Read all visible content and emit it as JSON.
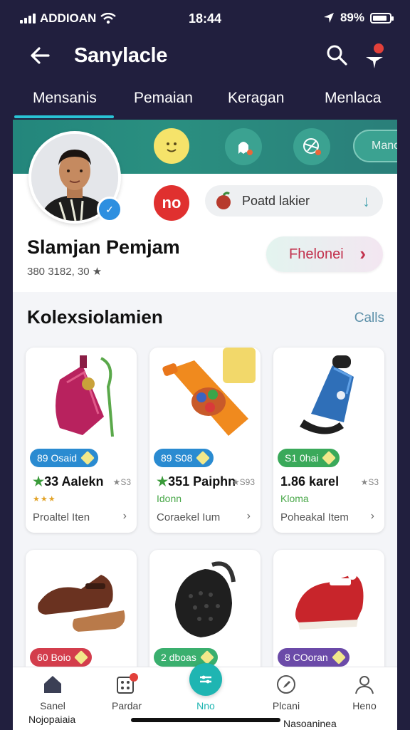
{
  "status": {
    "carrier": "ADDIOAN",
    "time": "18:44",
    "battery": "89%"
  },
  "header": {
    "title": "Sanylacle"
  },
  "tabs": [
    "Mensanis",
    "Pemaian",
    "Keragan",
    "Menlaca"
  ],
  "hero": {
    "chip_text": "Mano"
  },
  "profile": {
    "name": "Slamjan Pemjam",
    "meta": "380 3182, 30 ★",
    "badge_text": "no",
    "pill_label": "Poatd lakier",
    "follow_label": "Fhelonei"
  },
  "collection": {
    "title": "Kolexsiolamien",
    "link": "Calls",
    "items": [
      {
        "tag": "89 Osaid",
        "tag_color": "#2a8bd1",
        "name": "33 Aalekn",
        "name_star": "★",
        "rate": "★S3",
        "sub": "★★★",
        "foot": "Proaltel Iten"
      },
      {
        "tag": "89 S08",
        "tag_color": "#2a8bd1",
        "name": "351 Paiphn",
        "name_star": "★",
        "rate": "★S93",
        "sub": "Idonn",
        "foot": "Coraekel Ium"
      },
      {
        "tag": "S1 0hai",
        "tag_color": "#3aa95a",
        "name": "1.86 karel",
        "name_star": "",
        "rate": "★S3",
        "sub": "Kloma",
        "foot": "Poheakal Item"
      },
      {
        "tag": "60 Boio",
        "tag_color": "#d33d4c"
      },
      {
        "tag": "2 dboas",
        "tag_color": "#3aaf6e"
      },
      {
        "tag": "8 COoran",
        "tag_color": "#6b4aa8"
      }
    ]
  },
  "nav": {
    "items": [
      "Sanel",
      "Pardar",
      "Nno",
      "Plcani",
      "Heno"
    ],
    "footer_left": "Nojopaiaia",
    "footer_right": "Nasoaninea"
  }
}
